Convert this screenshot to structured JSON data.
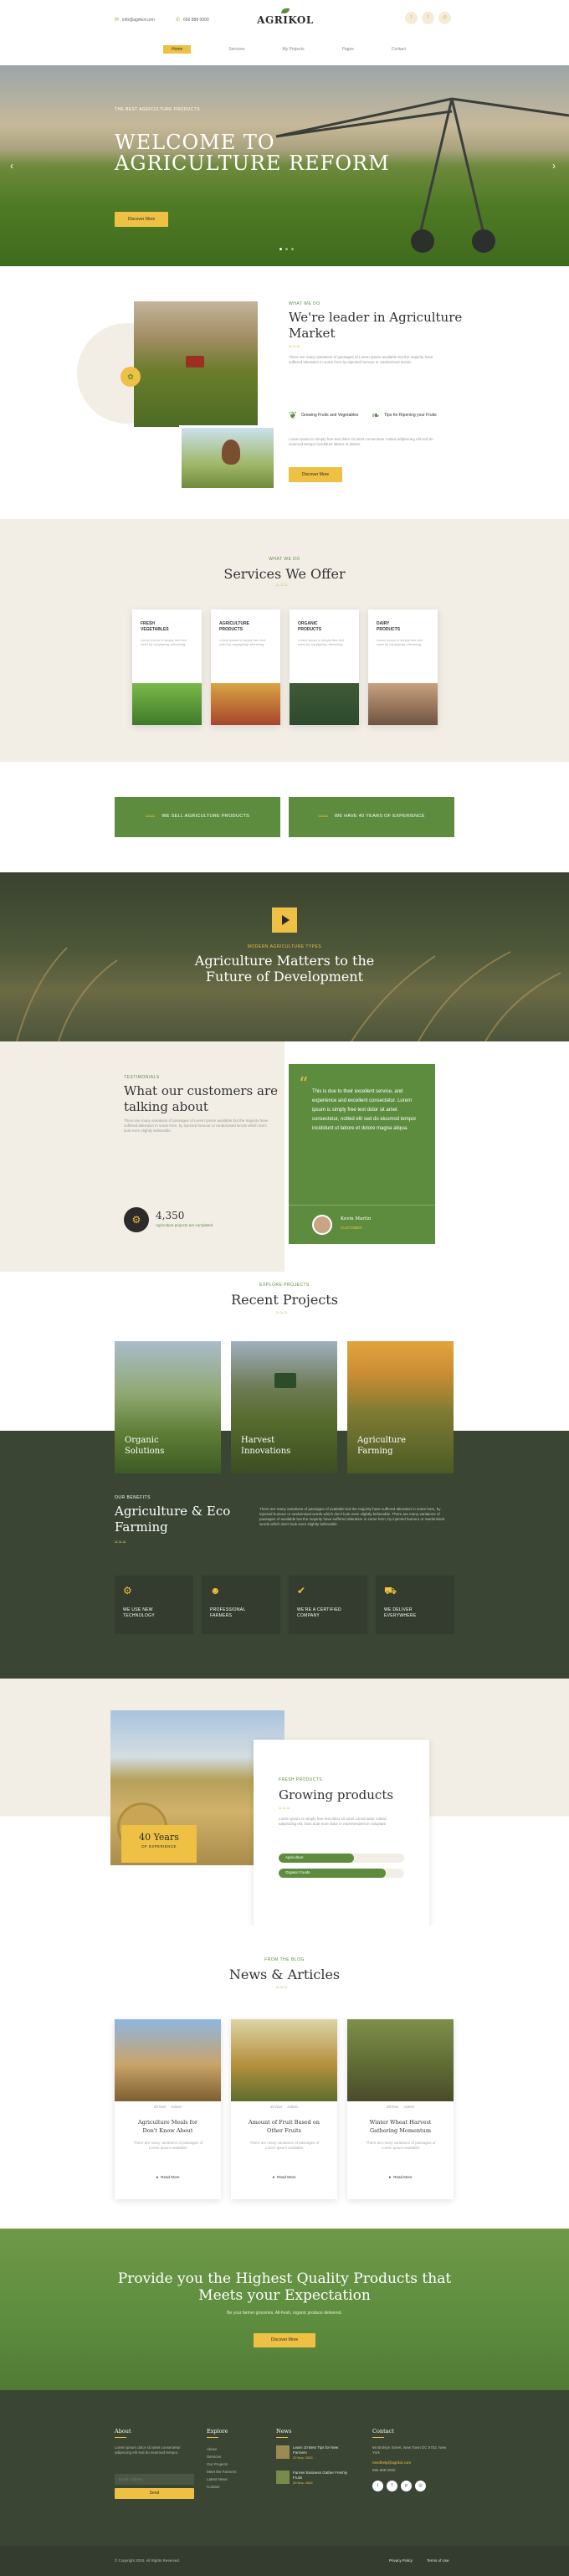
{
  "header": {
    "email": "info@agrikol.com",
    "phone": "666 888 0000",
    "logo": "AGRIKOL",
    "nav": [
      "Home",
      "Services",
      "My Projects",
      "Pages",
      "Contact"
    ]
  },
  "hero": {
    "kicker": "THE BEST AGRICULTURE PRODUCTS",
    "title_line1": "WELCOME TO",
    "title_line2": "AGRICULTURE REFORM",
    "button": "Discover More"
  },
  "about": {
    "kicker": "WHAT WE DO",
    "title_line1": "We're leader in Agriculture",
    "title_line2": "Market",
    "text": "There are many variations of passages of Lorem Ipsum available but the majority have suffered alteration in some form by injected humour or randomised words.",
    "feature1": "Growing Fruits and Vegetables",
    "feature2": "Tips for Ripening your Fruits",
    "text2": "Lorem ipsum is simply free text dolor sit amet consectetur notted adipisicing elit sed do eiusmod tempor incididunt labore et dolore.",
    "button": "Discover More"
  },
  "services": {
    "kicker": "WHAT WE DO",
    "title": "Services We Offer",
    "items": [
      {
        "title": "FRESH VEGETABLES",
        "text": "Lorem ipsum is simply free text used by copytyping refreshing."
      },
      {
        "title": "AGRICULTURE PRODUCTS",
        "text": "Lorem ipsum is simply free text used by copytyping refreshing."
      },
      {
        "title": "ORGANIC PRODUCTS",
        "text": "Lorem ipsum is simply free text used by copytyping refreshing."
      },
      {
        "title": "DAIRY PRODUCTS",
        "text": "Lorem ipsum is simply free text used by copytyping refreshing."
      }
    ]
  },
  "banners": {
    "left": "WE SELL AGRICULTURE PRODUCTS",
    "right": "WE HAVE 40 YEARS OF EXPERIENCE"
  },
  "video": {
    "kicker": "MODERN AGRICULTURE TYPES",
    "title_line1": "Agriculture Matters to the",
    "title_line2": "Future of Development"
  },
  "testimonials": {
    "kicker": "TESTIMONIALS",
    "title_line1": "What our customers are",
    "title_line2": "talking about",
    "text": "There are many variations of passages of Lorem Ipsum available but the majority have suffered alteration in some form, by injected humour or randomised words which don't look even slightly believable.",
    "count": "4,350",
    "count_label": "Agriculture projects are completed",
    "quote": "This is due to their excellent service, and experience and excellent consectetur. Lorem ipsum is simply free text dolor sit amet consectetur, notted elit sed do eiusmod tempor incididunt ut labore et dolore magna aliqua.",
    "author": "Kevin Martin",
    "author_role": "CUSTOMER"
  },
  "projects": {
    "kicker": "EXPLORE PROJECTS",
    "title": "Recent Projects",
    "items": [
      {
        "line1": "Organic",
        "line2": "Solutions"
      },
      {
        "line1": "Harvest",
        "line2": "Innovations"
      },
      {
        "line1": "Agriculture",
        "line2": "Farming"
      }
    ]
  },
  "benefits": {
    "kicker": "OUR BENEFITS",
    "title_line1": "Agriculture & Eco",
    "title_line2": "Farming",
    "text": "There are many variations of passages of available but the majority have suffered alteration in some form, by injected humour or randomised words which don't look even slightly believable. There are many variations of passages of available but the majority have suffered alteration in some form, by injected humour or randomised words which don't look even slightly believable.",
    "items": [
      {
        "line1": "WE USE NEW",
        "line2": "TECHNOLOGY"
      },
      {
        "line1": "PROFESSIONAL",
        "line2": "FARMERS"
      },
      {
        "line1": "WE'RE A CERTIFIED",
        "line2": "COMPANY"
      },
      {
        "line1": "WE DELIVER",
        "line2": "EVERYWHERE"
      }
    ]
  },
  "growing": {
    "years": "40 Years",
    "years_label": "OF EXPERIENCE",
    "kicker": "FRESH PRODUCTS",
    "title": "Growing products",
    "text": "Lorem ipsum is simply free text dolor sit amet consectetur notted adipisicing elit. Duis aute irure dolor in reprehenderit in voluptate.",
    "bar1_label": "Agriculture",
    "bar1_value": 0.6,
    "bar2_label": "Organic Foods",
    "bar2_value": 0.85
  },
  "news": {
    "kicker": "FROM THE BLOG",
    "title": "News & Articles",
    "items": [
      {
        "date": "20 Nov",
        "author": "Admin",
        "title_line1": "Agriculture Meals for",
        "title_line2": "Don't Know About",
        "text": "There are many variations of passages of Lorem Ipsum available.",
        "link": "Read More"
      },
      {
        "date": "20 Nov",
        "author": "Admin",
        "title_line1": "Amount of Fruit Based on",
        "title_line2": "Other Fruits",
        "text": "There are many variations of passages of Lorem Ipsum available.",
        "link": "Read More"
      },
      {
        "date": "20 Nov",
        "author": "Admin",
        "title_line1": "Winter Wheat Harvest",
        "title_line2": "Gathering Momentum",
        "text": "There are many variations of passages of Lorem Ipsum available.",
        "link": "Read More"
      }
    ]
  },
  "cta": {
    "title_line1": "Provide you the Highest Quality Products that",
    "title_line2": "Meets your Expectation",
    "text": "Be your farmer groceries. All-fresh, organic produce delivered.",
    "button": "Discover More"
  },
  "footer": {
    "about_title": "About",
    "about_text": "Lorem ipsum dolor sit amet consectetur adipiscing elit sed do eiusmod tempor.",
    "email_placeholder": "Email Address",
    "send": "Send",
    "explore_title": "Explore",
    "explore_links": [
      "About",
      "Services",
      "Our Projects",
      "Meet the Farmers",
      "Latest News",
      "Contact"
    ],
    "news_title": "News",
    "news_items": [
      {
        "title": "Learn 10 Best Tips for New Farmers",
        "date": "20 Nov, 2020"
      },
      {
        "title": "Farmer Business Gather Freshly Fruits",
        "date": "20 Nov, 2020"
      }
    ],
    "contact_title": "Contact",
    "address": "66 Broklyn Street, New Town DC 5752, New York",
    "email": "needhelp@agrikol.com",
    "phone": "666 888 0000",
    "copyright": "© Copyright 2020. All Rights Reserved.",
    "privacy": "Privacy Policy",
    "terms": "Terms of Use"
  },
  "colors": {
    "green": "#5d8c3e",
    "dark": "#3a4534",
    "yellow": "#eec044",
    "beige": "#f2eee6"
  }
}
